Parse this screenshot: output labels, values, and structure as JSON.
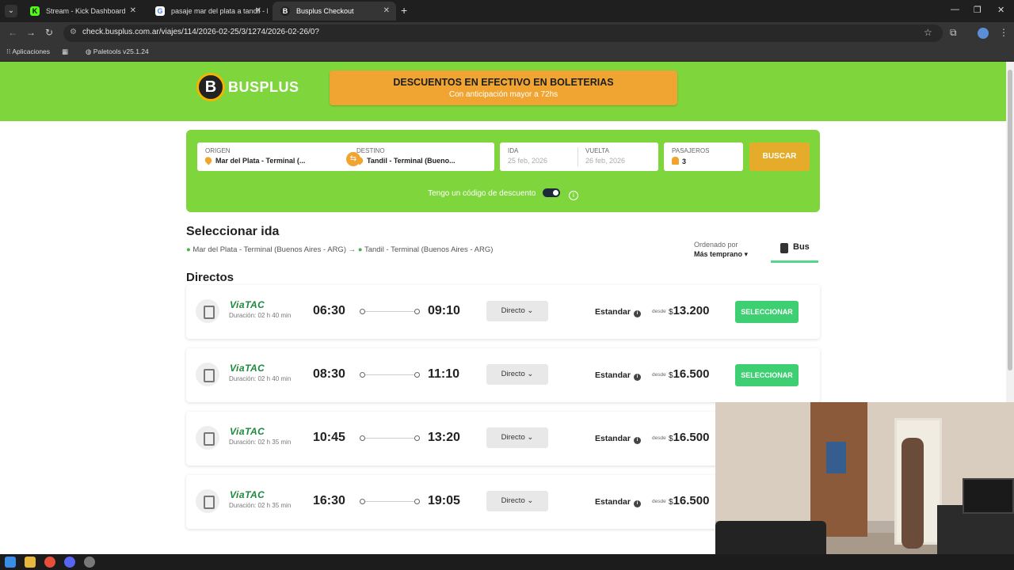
{
  "browser": {
    "tabs": [
      {
        "title": "Stream - Kick Dashboard",
        "active": false
      },
      {
        "title": "pasaje mar del plata a tandil - B",
        "active": false
      },
      {
        "title": "Busplus Checkout",
        "active": true
      }
    ],
    "url": "check.busplus.com.ar/viajes/114/2026-02-25/3/1274/2026-02-26/0?",
    "bookmarks": [
      "Aplicaciones",
      "Paletools v25.1.24"
    ]
  },
  "header": {
    "logo_letter": "B",
    "logo_text": "BUSPLUS",
    "promo_title": "DESCUENTOS EN EFECTIVO EN BOLETERIAS",
    "promo_subtitle": "Con anticipación mayor a 72hs",
    "brand_color": "#7ed63c",
    "accent_color": "#f0a532"
  },
  "search": {
    "origin_label": "ORIGEN",
    "origin_value": "Mar del Plata - Terminal (...",
    "destination_label": "DESTINO",
    "destination_value": "Tandil - Terminal (Bueno...",
    "ida_label": "IDA",
    "ida_value": "25 feb, 2026",
    "vuelta_label": "VUELTA",
    "vuelta_value": "26 feb, 2026",
    "pasajeros_label": "PASAJEROS",
    "pasajeros_value": "3",
    "buscar_label": "BUSCAR",
    "discount_label": "Tengo un código de descuento"
  },
  "results": {
    "title": "Seleccionar ida",
    "route_from": "Mar del Plata - Terminal (Buenos Aires - ARG)",
    "route_to": "Tandil - Terminal (Buenos Aires - ARG)",
    "order_label": "Ordenado por",
    "order_value": "Más temprano",
    "mode_tab": "Bus",
    "section": "Directos",
    "trips": [
      {
        "company": "ViaTAC",
        "duration": "Duración: 02 h 40 min",
        "depart": "06:30",
        "arrive": "09:10",
        "type": "Directo",
        "class": "Estandar",
        "from": "desde",
        "currency": "$",
        "price": "13.200",
        "button": "SELECCIONAR"
      },
      {
        "company": "ViaTAC",
        "duration": "Duración: 02 h 40 min",
        "depart": "08:30",
        "arrive": "11:10",
        "type": "Directo",
        "class": "Estandar",
        "from": "desde",
        "currency": "$",
        "price": "16.500",
        "button": "SELECCIONAR"
      },
      {
        "company": "ViaTAC",
        "duration": "Duración: 02 h 35 min",
        "depart": "10:45",
        "arrive": "13:20",
        "type": "Directo",
        "class": "Estandar",
        "from": "desde",
        "currency": "$",
        "price": "16.500",
        "button": ""
      },
      {
        "company": "ViaTAC",
        "duration": "Duración: 02 h 35 min",
        "depart": "16:30",
        "arrive": "19:05",
        "type": "Directo",
        "class": "Estandar",
        "from": "desde",
        "currency": "$",
        "price": "16.500",
        "button": ""
      }
    ]
  }
}
